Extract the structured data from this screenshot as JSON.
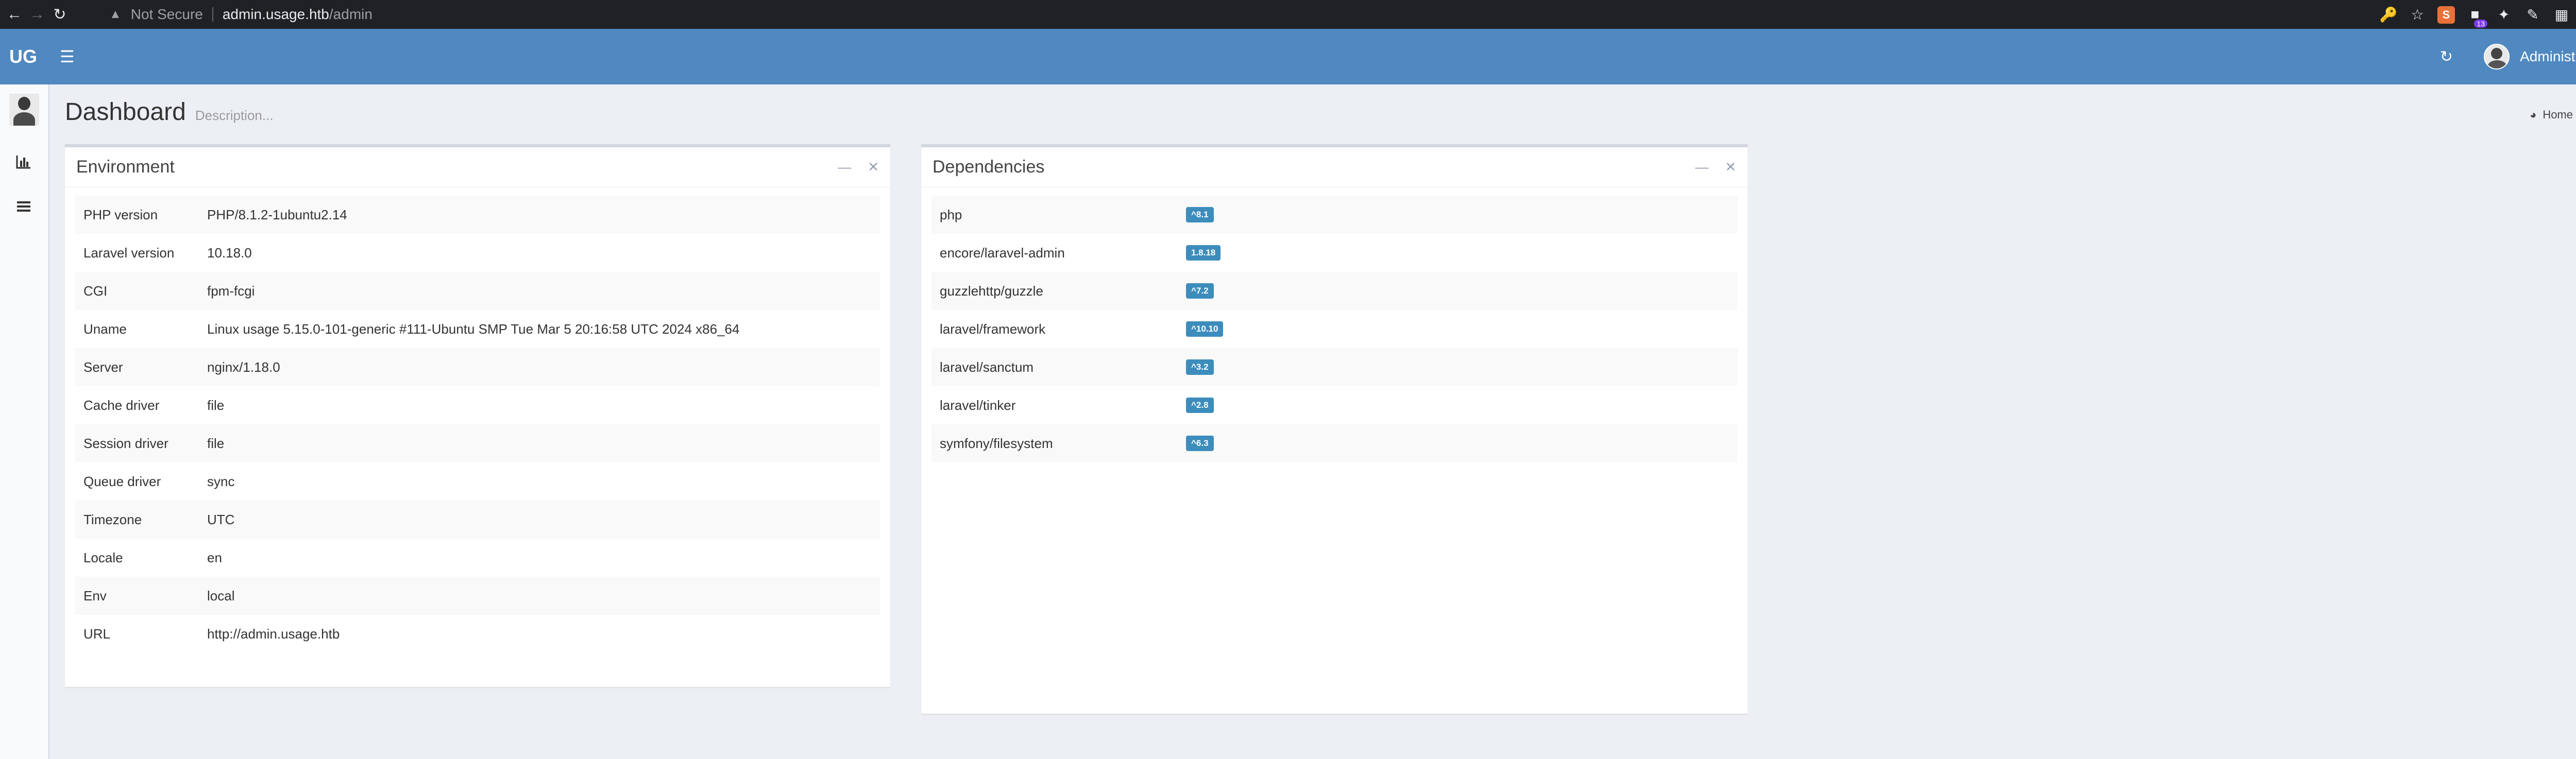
{
  "browser": {
    "security": "Not Secure",
    "url_host": "admin.usage.htb",
    "url_path": "/admin",
    "extension_badge": "13"
  },
  "header": {
    "logo": "UG",
    "user_name": "Administrator"
  },
  "page": {
    "title": "Dashboard",
    "description": "Description...",
    "breadcrumb": "Home"
  },
  "environment": {
    "title": "Environment",
    "rows": [
      {
        "key": "PHP version",
        "value": "PHP/8.1.2-1ubuntu2.14"
      },
      {
        "key": "Laravel version",
        "value": "10.18.0"
      },
      {
        "key": "CGI",
        "value": "fpm-fcgi"
      },
      {
        "key": "Uname",
        "value": "Linux usage 5.15.0-101-generic #111-Ubuntu SMP Tue Mar 5 20:16:58 UTC 2024 x86_64"
      },
      {
        "key": "Server",
        "value": "nginx/1.18.0"
      },
      {
        "key": "Cache driver",
        "value": "file"
      },
      {
        "key": "Session driver",
        "value": "file"
      },
      {
        "key": "Queue driver",
        "value": "sync"
      },
      {
        "key": "Timezone",
        "value": "UTC"
      },
      {
        "key": "Locale",
        "value": "en"
      },
      {
        "key": "Env",
        "value": "local"
      },
      {
        "key": "URL",
        "value": "http://admin.usage.htb"
      }
    ]
  },
  "dependencies": {
    "title": "Dependencies",
    "rows": [
      {
        "name": "php",
        "version": "^8.1"
      },
      {
        "name": "encore/laravel-admin",
        "version": "1.8.18"
      },
      {
        "name": "guzzlehttp/guzzle",
        "version": "^7.2"
      },
      {
        "name": "laravel/framework",
        "version": "^10.10"
      },
      {
        "name": "laravel/sanctum",
        "version": "^3.2"
      },
      {
        "name": "laravel/tinker",
        "version": "^2.8"
      },
      {
        "name": "symfony/filesystem",
        "version": "^6.3"
      }
    ]
  },
  "colors": {
    "header_bg": "#5088c0",
    "label_bg": "#3c8dbc",
    "page_bg": "#ecf0f5"
  }
}
